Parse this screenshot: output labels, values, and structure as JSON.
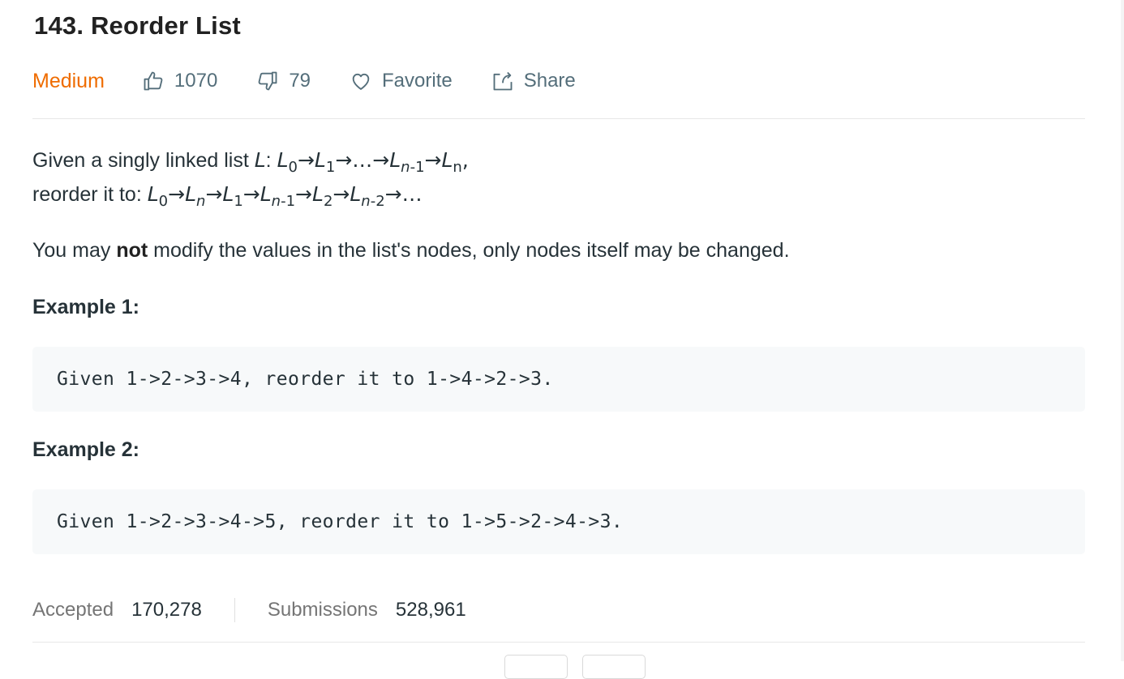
{
  "problem": {
    "title": "143. Reorder List",
    "difficulty": "Medium",
    "likes": "1070",
    "dislikes": "79",
    "favorite_label": "Favorite",
    "share_label": "Share",
    "difficulty_color": "#ef6c00"
  },
  "description": {
    "line1_prefix": "Given a singly linked list ",
    "line1_L": "L",
    "line1_colon": ": ",
    "line2_prefix": "reorder it to: ",
    "note_pre": "You may ",
    "note_bold": "not",
    "note_post": " modify the values in the list's nodes, only nodes itself may be changed."
  },
  "examples": [
    {
      "heading": "Example 1:",
      "code": "Given 1->2->3->4, reorder it to 1->4->2->3."
    },
    {
      "heading": "Example 2:",
      "code": "Given 1->2->3->4->5, reorder it to 1->5->2->4->3."
    }
  ],
  "stats": {
    "accepted_label": "Accepted",
    "accepted_value": "170,278",
    "submissions_label": "Submissions",
    "submissions_value": "528,961"
  },
  "icons": {
    "like": "thumbs-up-icon",
    "dislike": "thumbs-down-icon",
    "favorite": "heart-icon",
    "share": "share-icon"
  }
}
